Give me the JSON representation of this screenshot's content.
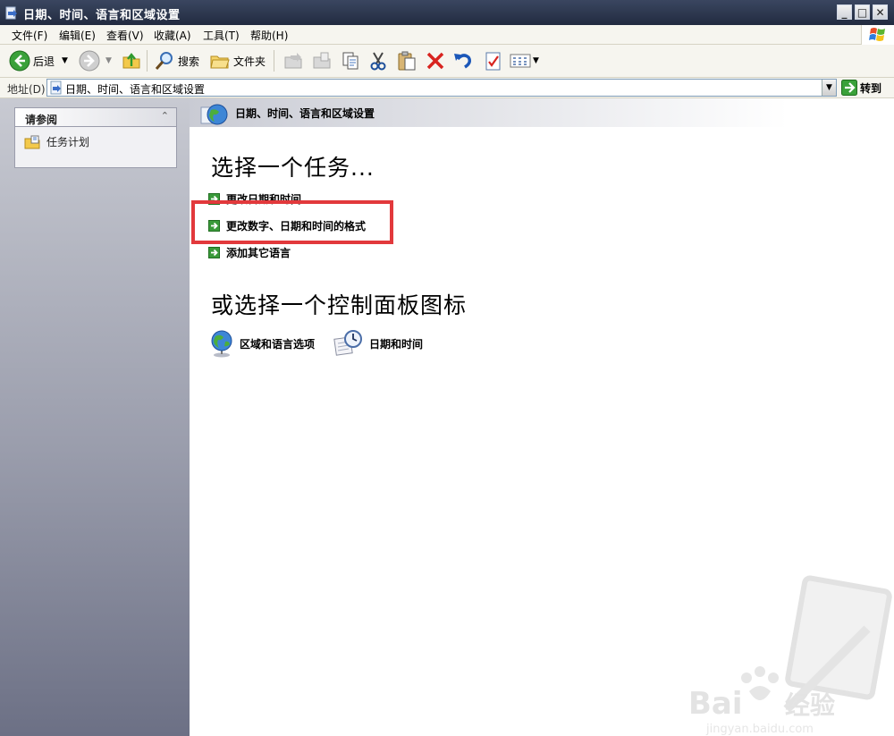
{
  "window": {
    "title": "日期、时间、语言和区域设置"
  },
  "menubar": {
    "items": [
      "文件(F)",
      "编辑(E)",
      "查看(V)",
      "收藏(A)",
      "工具(T)",
      "帮助(H)"
    ]
  },
  "toolbar": {
    "back_label": "后退",
    "search_label": "搜索",
    "folders_label": "文件夹"
  },
  "address": {
    "label": "地址(D)",
    "value": "日期、时间、语言和区域设置",
    "go_label": "转到"
  },
  "sidebar": {
    "panel_title": "请参阅",
    "items": [
      {
        "label": "任务计划",
        "icon": "scheduled-tasks-icon"
      }
    ]
  },
  "main": {
    "header_title": "日期、时间、语言和区域设置",
    "task_heading": "选择一个任务...",
    "tasks": [
      {
        "label": "更改日期和时间"
      },
      {
        "label": "更改数字、日期和时间的格式"
      },
      {
        "label": "添加其它语言"
      }
    ],
    "icon_heading": "或选择一个控制面板图标",
    "control_panel_icons": [
      {
        "label": "区域和语言选项",
        "icon": "globe-icon"
      },
      {
        "label": "日期和时间",
        "icon": "clock-calendar-icon"
      }
    ],
    "highlight_color": "#e2393c"
  },
  "watermark": {
    "brand": "Baidu 经验",
    "url": "jingyan.baidu.com"
  },
  "colors": {
    "titlebar": "#2c3650",
    "sidebar_top": "#c8cad2",
    "sidebar_bottom": "#6c7085",
    "task_arrow": "#3a9a3a"
  }
}
